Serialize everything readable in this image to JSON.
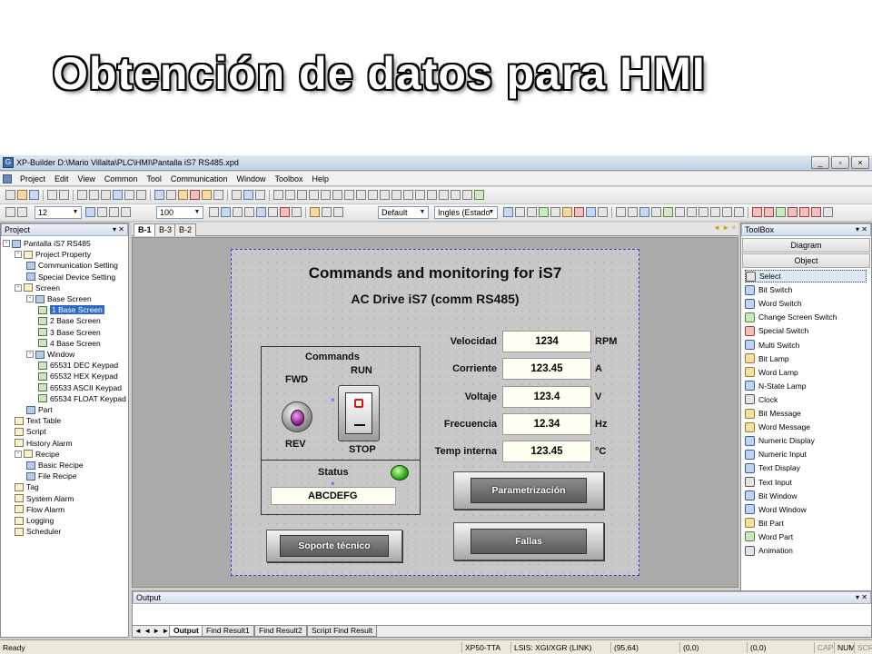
{
  "slide": {
    "title": "Obtención de datos para HMI"
  },
  "window": {
    "title": "XP-Builder D:\\Mario Villalta\\PLC\\HMI\\Pantalla iS7 RS485.xpd",
    "min": "_",
    "restore": "▫",
    "close": "×"
  },
  "menu": [
    "Project",
    "Edit",
    "View",
    "Common",
    "Tool",
    "Communication",
    "Window",
    "Toolbox",
    "Help"
  ],
  "toolbar": {
    "font_size": "12",
    "zoom": "100",
    "style": "Default",
    "language": "Inglés (Estado"
  },
  "project_panel": {
    "title": "Project",
    "items": [
      {
        "label": "Pantalla iS7 RS485",
        "level": 0,
        "exp": "-"
      },
      {
        "label": "Project Property",
        "level": 1,
        "exp": "-"
      },
      {
        "label": "Communication Setting",
        "level": 2,
        "exp": ""
      },
      {
        "label": "Special Device Setting",
        "level": 2,
        "exp": ""
      },
      {
        "label": "Screen",
        "level": 1,
        "exp": "-"
      },
      {
        "label": "Base Screen",
        "level": 2,
        "exp": "-"
      },
      {
        "label": "1 Base Screen",
        "level": 3,
        "exp": "",
        "selected": true
      },
      {
        "label": "2 Base Screen",
        "level": 3,
        "exp": ""
      },
      {
        "label": "3 Base Screen",
        "level": 3,
        "exp": ""
      },
      {
        "label": "4 Base Screen",
        "level": 3,
        "exp": ""
      },
      {
        "label": "Window",
        "level": 2,
        "exp": "-"
      },
      {
        "label": "65531 DEC Keypad",
        "level": 3,
        "exp": ""
      },
      {
        "label": "65532 HEX Keypad",
        "level": 3,
        "exp": ""
      },
      {
        "label": "65533 ASCII Keypad",
        "level": 3,
        "exp": ""
      },
      {
        "label": "65534 FLOAT Keypad",
        "level": 3,
        "exp": ""
      },
      {
        "label": "Part",
        "level": 2,
        "exp": ""
      },
      {
        "label": "Text Table",
        "level": 1,
        "exp": ""
      },
      {
        "label": "Script",
        "level": 1,
        "exp": ""
      },
      {
        "label": "History Alarm",
        "level": 1,
        "exp": ""
      },
      {
        "label": "Recipe",
        "level": 1,
        "exp": "-"
      },
      {
        "label": "Basic Recipe",
        "level": 2,
        "exp": ""
      },
      {
        "label": "File Recipe",
        "level": 2,
        "exp": ""
      },
      {
        "label": "Tag",
        "level": 1,
        "exp": ""
      },
      {
        "label": "System Alarm",
        "level": 1,
        "exp": ""
      },
      {
        "label": "Flow Alarm",
        "level": 1,
        "exp": ""
      },
      {
        "label": "Logging",
        "level": 1,
        "exp": ""
      },
      {
        "label": "Scheduler",
        "level": 1,
        "exp": ""
      }
    ]
  },
  "editor": {
    "tabs": [
      "B-1",
      "B-3",
      "B-2"
    ],
    "arrows": "◄ ► ×",
    "screen": {
      "title": "Commands and monitoring for iS7",
      "subtitle": "AC Drive iS7 (comm RS485)",
      "commands_label": "Commands",
      "fwd": "FWD",
      "rev": "REV",
      "run": "RUN",
      "stop": "STOP",
      "status_label": "Status",
      "status_text": "ABCDEFG",
      "params": [
        {
          "label": "Velocidad",
          "value": "1234",
          "unit": "RPM"
        },
        {
          "label": "Corriente",
          "value": "123.45",
          "unit": "A"
        },
        {
          "label": "Voltaje",
          "value": "123.4",
          "unit": "V"
        },
        {
          "label": "Frecuencia",
          "value": "12.34",
          "unit": "Hz"
        },
        {
          "label": "Temp interna",
          "value": "123.45",
          "unit": "°C"
        }
      ],
      "btn_param": "Parametrización",
      "btn_fallas": "Fallas",
      "btn_soporte": "Soporte técnico"
    }
  },
  "toolbox": {
    "title": "ToolBox",
    "sections": [
      "Diagram",
      "Object"
    ],
    "items": [
      "Select",
      "Bit Switch",
      "Word Switch",
      "Change Screen Switch",
      "Special Switch",
      "Multi Switch",
      "Bit Lamp",
      "Word Lamp",
      "N-State Lamp",
      "Clock",
      "Bit Message",
      "Word Message",
      "Numeric Display",
      "Numeric Input",
      "Text Display",
      "Text Input",
      "Bit Window",
      "Word Window",
      "Bit Part",
      "Word Part",
      "Animation"
    ]
  },
  "output": {
    "title": "Output",
    "nav": "◄ ◄ ► ►",
    "tabs": [
      "Output",
      "Find Result1",
      "Find Result2",
      "Script Find Result"
    ]
  },
  "statusbar": {
    "ready": "Ready",
    "device": "XP50-TTA",
    "plc": "LSIS: XGI/XGR (LINK)",
    "cursor": "(95,64)",
    "pos1": "(0,0)",
    "pos2": "(0,0)",
    "cap": "CAP",
    "num": "NUM",
    "scrl": "SCRL"
  }
}
